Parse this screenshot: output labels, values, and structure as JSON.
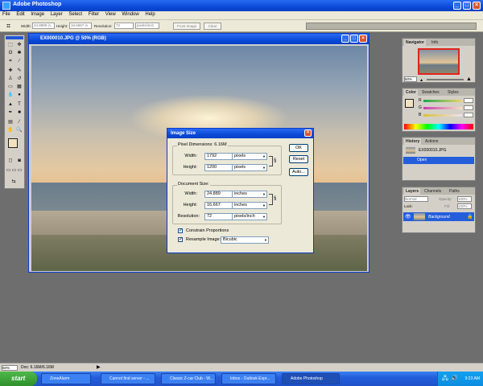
{
  "app": {
    "title": "Adobe Photoshop",
    "menu": [
      "File",
      "Edit",
      "Image",
      "Layer",
      "Select",
      "Filter",
      "View",
      "Window",
      "Help"
    ]
  },
  "options_bar": {
    "width_label": "Width:",
    "width_placeholder": "24.8889 in",
    "height_label": "Height:",
    "height_placeholder": "16.6667 in",
    "resolution_label": "Resolution:",
    "resolution_value": "72",
    "resolution_unit": "pixels/inch",
    "front_image_label": "Front Image",
    "clear_label": "Clear"
  },
  "image_window": {
    "title": "EX000010.JPG @ 50% (RGB)"
  },
  "dialog": {
    "title": "Image Size",
    "pixel_dimensions_label": "Pixel Dimensions: 6.16M",
    "width_label": "Width:",
    "width_value": "1792",
    "width_unit": "pixels",
    "height_label": "Height:",
    "height_value": "1200",
    "height_unit": "pixels",
    "document_size_label": "Document Size:",
    "doc_width_label": "Width:",
    "doc_width_value": "24.889",
    "doc_width_unit": "inches",
    "doc_height_label": "Height:",
    "doc_height_value": "16.667",
    "doc_height_unit": "inches",
    "resolution_label": "Resolution:",
    "resolution_value": "72",
    "resolution_unit": "pixels/inch",
    "constrain_label": "Constrain Proportions",
    "constrain_checked": "✓",
    "resample_label": "Resample Image:",
    "resample_checked": "✓",
    "resample_method": "Bicubic",
    "ok_label": "OK",
    "reset_label": "Reset",
    "auto_label": "Auto..."
  },
  "palettes": {
    "navigator_tabs": [
      "Navigator",
      "Info"
    ],
    "navigator_zoom": "50%",
    "color_tabs": [
      "Color",
      "Swatches",
      "Styles"
    ],
    "color_channels": [
      "R",
      "G",
      "B"
    ],
    "history_tabs": [
      "History",
      "Actions"
    ],
    "history_snapshot": "EX000010.JPG",
    "history_step": "Open",
    "layers_tabs": [
      "Layers",
      "Channels",
      "Paths"
    ],
    "blend_mode": "Normal",
    "opacity_label": "Opacity:",
    "opacity_value": "100%",
    "lock_label": "Lock:",
    "fill_label": "Fill:",
    "fill_value": "100%",
    "layer_name": "Background"
  },
  "status_bar": {
    "zoom": "50%",
    "doc_info": "Doc: 6.16M/6.16M"
  },
  "taskbar": {
    "start_label": "start",
    "tasks": [
      "ZoneAlarm",
      "Cannot find server - ...",
      "Classic Z-car Club - W...",
      "Inbox - Outlook Expr...",
      "Adobe Photoshop"
    ],
    "clock": "9:23 AM"
  }
}
